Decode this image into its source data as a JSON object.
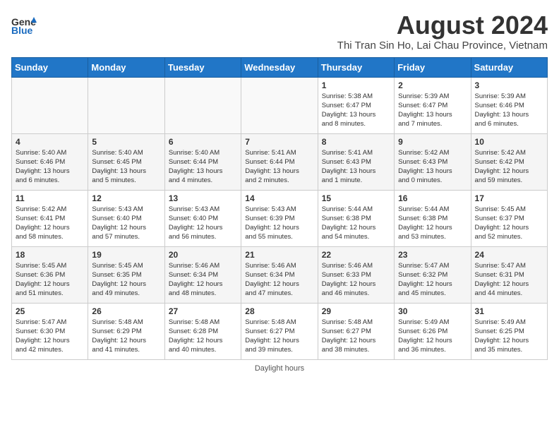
{
  "logo": {
    "general": "General",
    "blue": "Blue"
  },
  "title": "August 2024",
  "subtitle": "Thi Tran Sin Ho, Lai Chau Province, Vietnam",
  "headers": [
    "Sunday",
    "Monday",
    "Tuesday",
    "Wednesday",
    "Thursday",
    "Friday",
    "Saturday"
  ],
  "weeks": [
    [
      {
        "day": "",
        "info": ""
      },
      {
        "day": "",
        "info": ""
      },
      {
        "day": "",
        "info": ""
      },
      {
        "day": "",
        "info": ""
      },
      {
        "day": "1",
        "info": "Sunrise: 5:38 AM\nSunset: 6:47 PM\nDaylight: 13 hours\nand 8 minutes."
      },
      {
        "day": "2",
        "info": "Sunrise: 5:39 AM\nSunset: 6:47 PM\nDaylight: 13 hours\nand 7 minutes."
      },
      {
        "day": "3",
        "info": "Sunrise: 5:39 AM\nSunset: 6:46 PM\nDaylight: 13 hours\nand 6 minutes."
      }
    ],
    [
      {
        "day": "4",
        "info": "Sunrise: 5:40 AM\nSunset: 6:46 PM\nDaylight: 13 hours\nand 6 minutes."
      },
      {
        "day": "5",
        "info": "Sunrise: 5:40 AM\nSunset: 6:45 PM\nDaylight: 13 hours\nand 5 minutes."
      },
      {
        "day": "6",
        "info": "Sunrise: 5:40 AM\nSunset: 6:44 PM\nDaylight: 13 hours\nand 4 minutes."
      },
      {
        "day": "7",
        "info": "Sunrise: 5:41 AM\nSunset: 6:44 PM\nDaylight: 13 hours\nand 2 minutes."
      },
      {
        "day": "8",
        "info": "Sunrise: 5:41 AM\nSunset: 6:43 PM\nDaylight: 13 hours\nand 1 minute."
      },
      {
        "day": "9",
        "info": "Sunrise: 5:42 AM\nSunset: 6:43 PM\nDaylight: 13 hours\nand 0 minutes."
      },
      {
        "day": "10",
        "info": "Sunrise: 5:42 AM\nSunset: 6:42 PM\nDaylight: 12 hours\nand 59 minutes."
      }
    ],
    [
      {
        "day": "11",
        "info": "Sunrise: 5:42 AM\nSunset: 6:41 PM\nDaylight: 12 hours\nand 58 minutes."
      },
      {
        "day": "12",
        "info": "Sunrise: 5:43 AM\nSunset: 6:40 PM\nDaylight: 12 hours\nand 57 minutes."
      },
      {
        "day": "13",
        "info": "Sunrise: 5:43 AM\nSunset: 6:40 PM\nDaylight: 12 hours\nand 56 minutes."
      },
      {
        "day": "14",
        "info": "Sunrise: 5:43 AM\nSunset: 6:39 PM\nDaylight: 12 hours\nand 55 minutes."
      },
      {
        "day": "15",
        "info": "Sunrise: 5:44 AM\nSunset: 6:38 PM\nDaylight: 12 hours\nand 54 minutes."
      },
      {
        "day": "16",
        "info": "Sunrise: 5:44 AM\nSunset: 6:38 PM\nDaylight: 12 hours\nand 53 minutes."
      },
      {
        "day": "17",
        "info": "Sunrise: 5:45 AM\nSunset: 6:37 PM\nDaylight: 12 hours\nand 52 minutes."
      }
    ],
    [
      {
        "day": "18",
        "info": "Sunrise: 5:45 AM\nSunset: 6:36 PM\nDaylight: 12 hours\nand 51 minutes."
      },
      {
        "day": "19",
        "info": "Sunrise: 5:45 AM\nSunset: 6:35 PM\nDaylight: 12 hours\nand 49 minutes."
      },
      {
        "day": "20",
        "info": "Sunrise: 5:46 AM\nSunset: 6:34 PM\nDaylight: 12 hours\nand 48 minutes."
      },
      {
        "day": "21",
        "info": "Sunrise: 5:46 AM\nSunset: 6:34 PM\nDaylight: 12 hours\nand 47 minutes."
      },
      {
        "day": "22",
        "info": "Sunrise: 5:46 AM\nSunset: 6:33 PM\nDaylight: 12 hours\nand 46 minutes."
      },
      {
        "day": "23",
        "info": "Sunrise: 5:47 AM\nSunset: 6:32 PM\nDaylight: 12 hours\nand 45 minutes."
      },
      {
        "day": "24",
        "info": "Sunrise: 5:47 AM\nSunset: 6:31 PM\nDaylight: 12 hours\nand 44 minutes."
      }
    ],
    [
      {
        "day": "25",
        "info": "Sunrise: 5:47 AM\nSunset: 6:30 PM\nDaylight: 12 hours\nand 42 minutes."
      },
      {
        "day": "26",
        "info": "Sunrise: 5:48 AM\nSunset: 6:29 PM\nDaylight: 12 hours\nand 41 minutes."
      },
      {
        "day": "27",
        "info": "Sunrise: 5:48 AM\nSunset: 6:28 PM\nDaylight: 12 hours\nand 40 minutes."
      },
      {
        "day": "28",
        "info": "Sunrise: 5:48 AM\nSunset: 6:27 PM\nDaylight: 12 hours\nand 39 minutes."
      },
      {
        "day": "29",
        "info": "Sunrise: 5:48 AM\nSunset: 6:27 PM\nDaylight: 12 hours\nand 38 minutes."
      },
      {
        "day": "30",
        "info": "Sunrise: 5:49 AM\nSunset: 6:26 PM\nDaylight: 12 hours\nand 36 minutes."
      },
      {
        "day": "31",
        "info": "Sunrise: 5:49 AM\nSunset: 6:25 PM\nDaylight: 12 hours\nand 35 minutes."
      }
    ]
  ],
  "footer": "Daylight hours"
}
